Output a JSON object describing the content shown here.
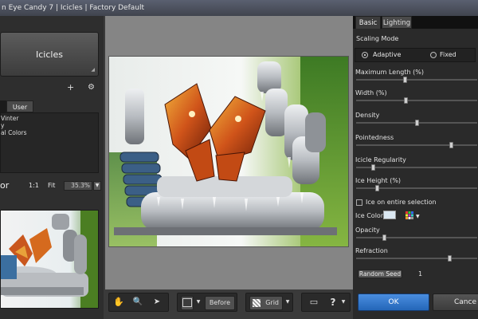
{
  "window": {
    "title": "n Eye Candy 7 | Icicles | Factory Default"
  },
  "presets": {
    "name": "Icicles",
    "tabs": [
      "",
      "User"
    ],
    "items": [
      "Vinter",
      "y",
      "al Colors"
    ]
  },
  "zoom": {
    "label": "or",
    "one_to_one": "1:1",
    "fit": "Fit",
    "value": "35.3%"
  },
  "toolbar": {
    "before_label": "Before",
    "grid_label": "Grid",
    "help_label": "?"
  },
  "right": {
    "tabs": {
      "basic": "Basic",
      "lighting": "Lighting"
    },
    "scaling_mode": {
      "title": "Scaling Mode",
      "options": [
        "Adaptive",
        "Fixed"
      ],
      "selected": "Adaptive"
    },
    "params": [
      {
        "label": "Maximum Length (%)",
        "value": 0.4
      },
      {
        "label": "Width (%)",
        "value": 0.41
      },
      {
        "label": "Density",
        "value": 0.5
      },
      {
        "label": "Pointedness",
        "value": 0.78
      },
      {
        "label": "Icicle Regularity",
        "value": 0.14
      },
      {
        "label": "Ice Height (%)",
        "value": 0.17
      }
    ],
    "ice_on_entire": {
      "label": "Ice on entire selection",
      "checked": false
    },
    "ice_color": {
      "label": "Ice Color",
      "color": "#dbe8f2"
    },
    "params2": [
      {
        "label": "Opacity",
        "value": 0.23
      },
      {
        "label": "Refraction",
        "value": 0.77
      }
    ],
    "random_seed": {
      "label": "Random Seed",
      "value": "1"
    },
    "ok": "OK",
    "cancel": "Cance"
  },
  "colors": {
    "accent": "#2f78cf"
  }
}
